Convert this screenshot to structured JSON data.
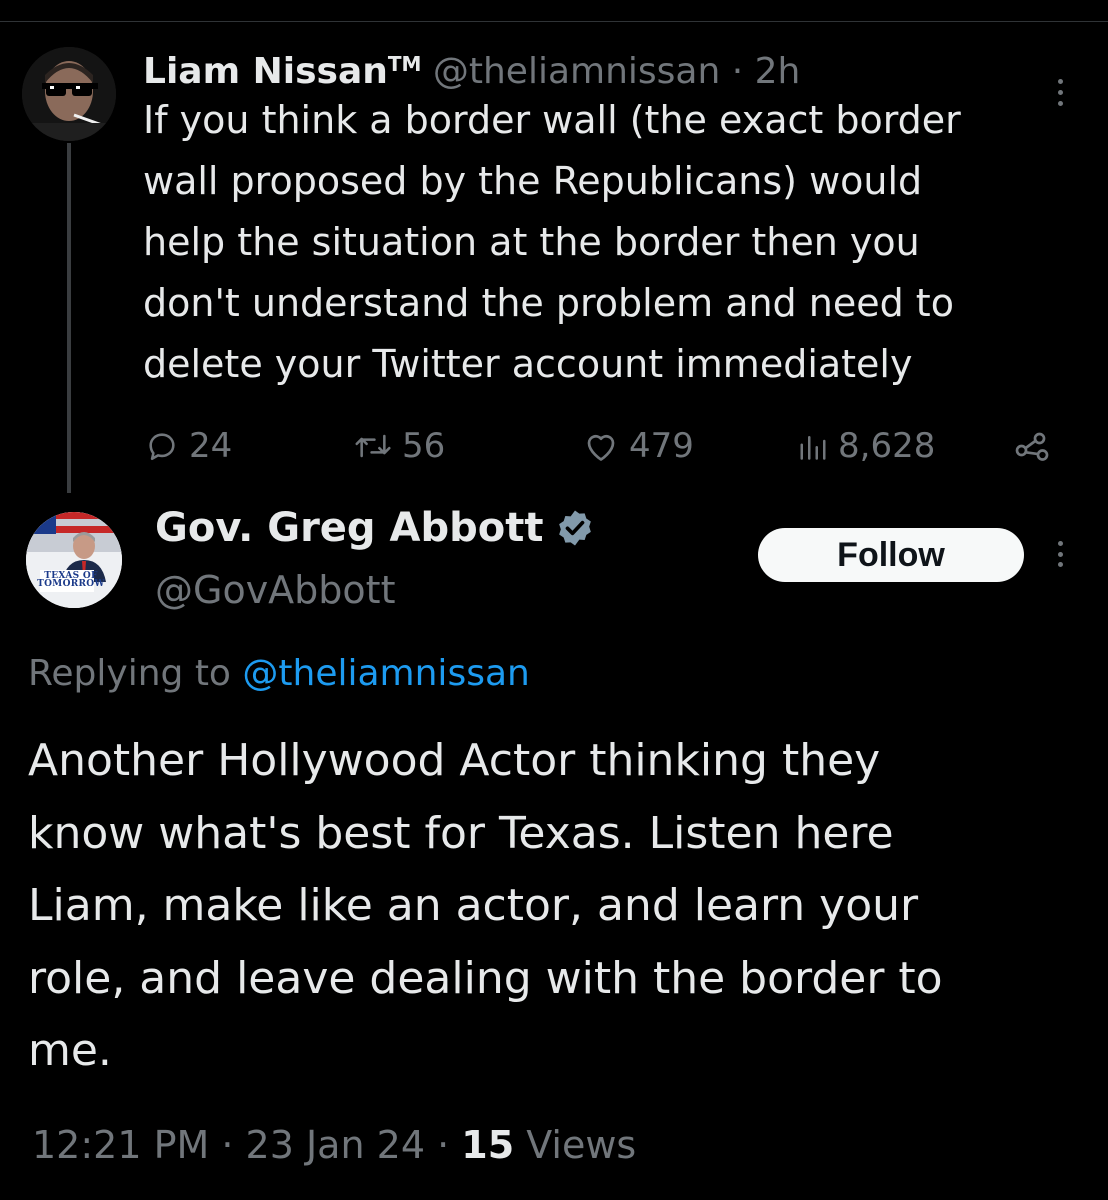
{
  "tweet1": {
    "author_name": "Liam Nissan",
    "trademark": "TM",
    "handle": "@theliamnissan",
    "separator": " · ",
    "time": "2h",
    "text": "If you think a border wall (the exact border\nwall proposed by the Republicans) would\nhelp the situation at the border then you\ndon't understand the problem and need to\ndelete your Twitter account immediately",
    "replies": "24",
    "reposts": "56",
    "likes": "479",
    "views": "8,628",
    "icons": [
      "reply-icon",
      "repost-icon",
      "like-icon",
      "views-icon",
      "share-icon",
      "more-icon"
    ]
  },
  "tweet2": {
    "author_name": "Gov. Greg Abbott",
    "handle": "@GovAbbott",
    "verified": true,
    "follow_label": "Follow",
    "avatar_caption_line1": "TEXAS OF",
    "avatar_caption_line2": "TOMORROW",
    "replying_prefix": "Replying to ",
    "replying_handle": "@theliamnissan",
    "text": "Another Hollywood Actor thinking they\nknow what's best for Texas.  Listen here\nLiam, make like an actor, and learn your\nrole, and leave dealing with the border to\nme.",
    "time": "12:21 PM",
    "date": "23 Jan 24",
    "sep": " · ",
    "views_count": "15",
    "views_label": " Views"
  },
  "colors": {
    "background": "#000000",
    "text": "#e7e9ea",
    "secondary": "#71767b",
    "link": "#1d9bf0",
    "verified_badge": "#829aab"
  }
}
